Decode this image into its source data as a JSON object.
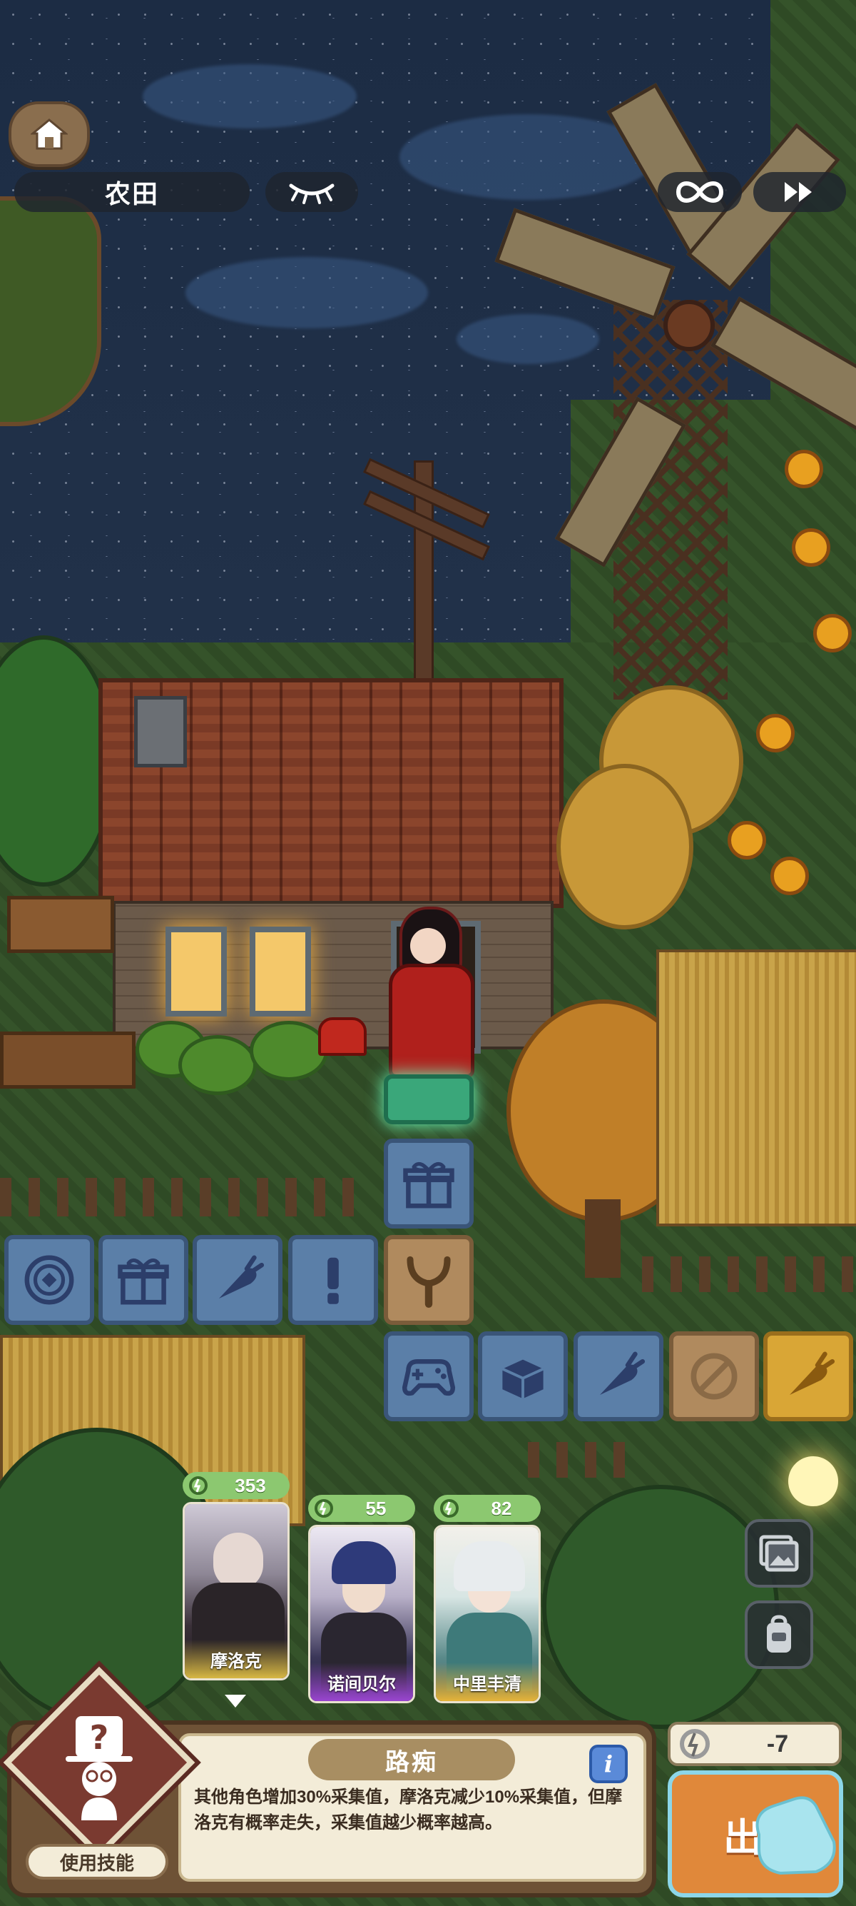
{
  "hud": {
    "location": "农田",
    "eye_icon": "closed-eye-icon",
    "loop_icon": "infinity-icon",
    "speed_icon": "fast-forward-icon"
  },
  "characters": [
    {
      "name": "摩洛克",
      "energy": "353",
      "selected": true,
      "name_color": "#f2d46a"
    },
    {
      "name": "诺间贝尔",
      "energy": "55",
      "selected": false,
      "name_color": "#a14fd8"
    },
    {
      "name": "中里丰清",
      "energy": "82",
      "selected": false,
      "name_color": "#f2c040"
    }
  ],
  "board_tiles": [
    {
      "icon": "gift-icon",
      "style": "blue"
    },
    {
      "icon": "coin-icon",
      "style": "blue"
    },
    {
      "icon": "gift-icon",
      "style": "blue"
    },
    {
      "icon": "carrot-icon",
      "style": "blue"
    },
    {
      "icon": "exclamation-icon",
      "style": "blue"
    },
    {
      "icon": "slingshot-icon",
      "style": "brown"
    },
    {
      "icon": "gamepad-icon",
      "style": "blue"
    },
    {
      "icon": "box-icon",
      "style": "blue"
    },
    {
      "icon": "carrot-icon",
      "style": "blue"
    },
    {
      "icon": "blocked-icon",
      "style": "brown"
    },
    {
      "icon": "carrot-icon",
      "style": "gold"
    }
  ],
  "skill": {
    "title": "路痴",
    "description": "其他角色增加30%采集值，摩洛克减少10%采集值，但摩洛克有概率走失，采集值越少概率越高。",
    "use_label": "使用技能",
    "info_label": "i"
  },
  "action": {
    "cost": "-7",
    "go_label": "出"
  },
  "colors": {
    "energy_green": "#8cc870",
    "panel_brown": "#6e5236",
    "go_orange": "#e0883a"
  }
}
